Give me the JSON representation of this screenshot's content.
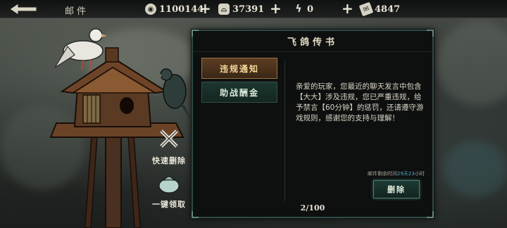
{
  "header": {
    "title": "邮件",
    "resources": [
      {
        "icon": "coin-icon",
        "value": "1100144"
      },
      {
        "icon": "ingot-icon",
        "value": "37391"
      },
      {
        "icon": "lightning-icon",
        "value": "0"
      },
      {
        "icon": "ticket-icon",
        "value": "4847"
      }
    ]
  },
  "actions": {
    "quick_delete": "快速删除",
    "collect_all": "一键领取"
  },
  "mail": {
    "panel_title": "飞鸽传书",
    "tabs": [
      {
        "label": "违规通知",
        "active": true
      },
      {
        "label": "助战酬金",
        "active": false
      }
    ],
    "body": "亲爱的玩家，您最近的聊天发言中包含【大大】涉及违规，您已严重违规，给予禁言【60分钟】的惩罚，还请遵守游戏规则，感谢您的支持与理解！",
    "expire_prefix": "邮件剩余时间",
    "expire_value": "29天23",
    "expire_suffix": "小时",
    "delete_label": "删除",
    "pager": "2/100"
  },
  "colors": {
    "panel_border": "#2e4a46",
    "active_tab": "#5c3e22",
    "teal_button": "#1e3a34",
    "expire_highlight": "#4fb0c8"
  }
}
